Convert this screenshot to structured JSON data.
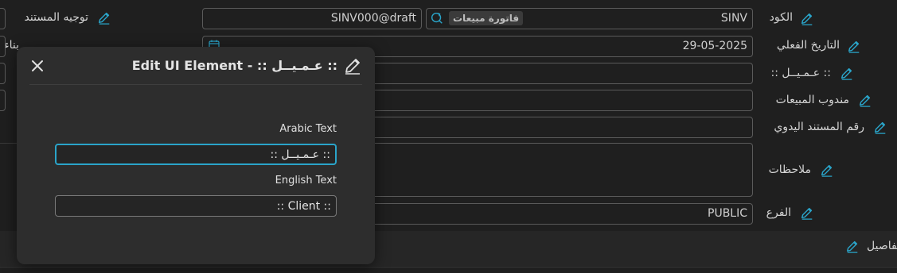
{
  "colors": {
    "accent": "#2aa4c9",
    "background": "#1f1f1f",
    "modal": "#2d2d2d"
  },
  "form": {
    "code": {
      "label": "الكود",
      "value": "SINV",
      "badge": "فاتورة مبيعات"
    },
    "draft_value": "SINV000@draft",
    "doc_direction": {
      "label": "توجيه المستند"
    },
    "actual_date": {
      "label": "التاريخ الفعلي",
      "value": "29-05-2025"
    },
    "customer": {
      "label": ":: عـمـيــل ::"
    },
    "sales_rep": {
      "label": "مندوب المبيعات"
    },
    "manual_doc_no": {
      "label": "رقم المستند اليدوي"
    },
    "notes": {
      "label": "ملاحظات"
    },
    "branch": {
      "label": "الفرع",
      "value": "PUBLIC"
    },
    "partial_left_label": "بناءا على",
    "details_label": "تفاصيل"
  },
  "modal": {
    "title": "Edit UI Element - :: عـمـيــل ::",
    "arabic_label": "Arabic Text",
    "arabic_value": ":: عـمـيــل ::",
    "english_label": "English Text",
    "english_value": ":: Client ::"
  }
}
